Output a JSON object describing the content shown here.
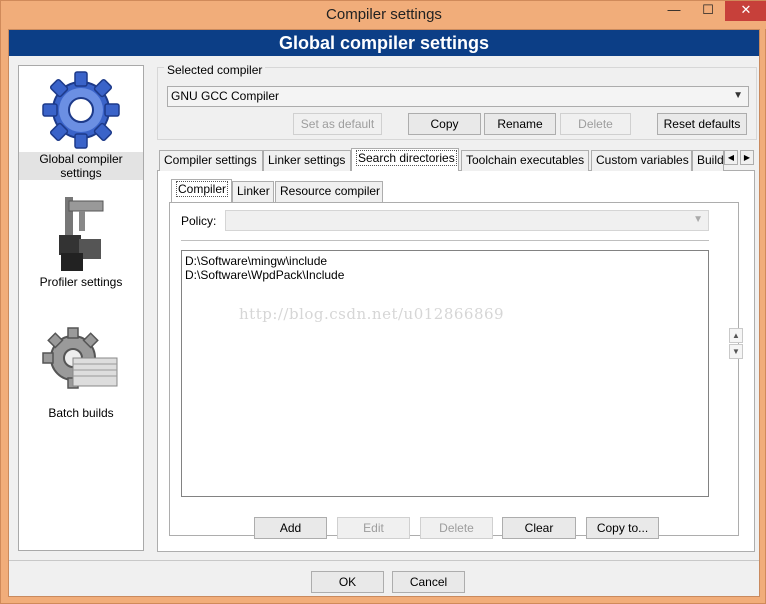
{
  "window": {
    "title": "Compiler settings",
    "min": "—",
    "max": "☐",
    "close": "✕"
  },
  "banner": "Global compiler settings",
  "nav": [
    {
      "label": "Global compiler settings",
      "icon": "gear-icon"
    },
    {
      "label": "Profiler settings",
      "icon": "profiler-icon"
    },
    {
      "label": "Batch builds",
      "icon": "batch-builds-icon"
    }
  ],
  "selected_compiler": {
    "group_label": "Selected compiler",
    "value": "GNU GCC Compiler",
    "buttons": {
      "set_default": "Set as default",
      "copy": "Copy",
      "rename": "Rename",
      "delete": "Delete",
      "reset": "Reset defaults"
    }
  },
  "tabs": [
    "Compiler settings",
    "Linker settings",
    "Search directories",
    "Toolchain executables",
    "Custom variables",
    "Build"
  ],
  "subtabs": [
    "Compiler",
    "Linker",
    "Resource compiler"
  ],
  "policy": {
    "label": "Policy:",
    "value": ""
  },
  "directories": [
    "D:\\Software\\mingw\\include",
    "D:\\Software\\WpdPack\\Include"
  ],
  "watermark": "http://blog.csdn.net/u012866869",
  "list_buttons": {
    "add": "Add",
    "edit": "Edit",
    "delete": "Delete",
    "clear": "Clear",
    "copy_to": "Copy to..."
  },
  "dialog_buttons": {
    "ok": "OK",
    "cancel": "Cancel"
  },
  "colors": {
    "banner": "#0c3e86",
    "titlebar": "#f1ad7a",
    "close": "#c7403a"
  }
}
